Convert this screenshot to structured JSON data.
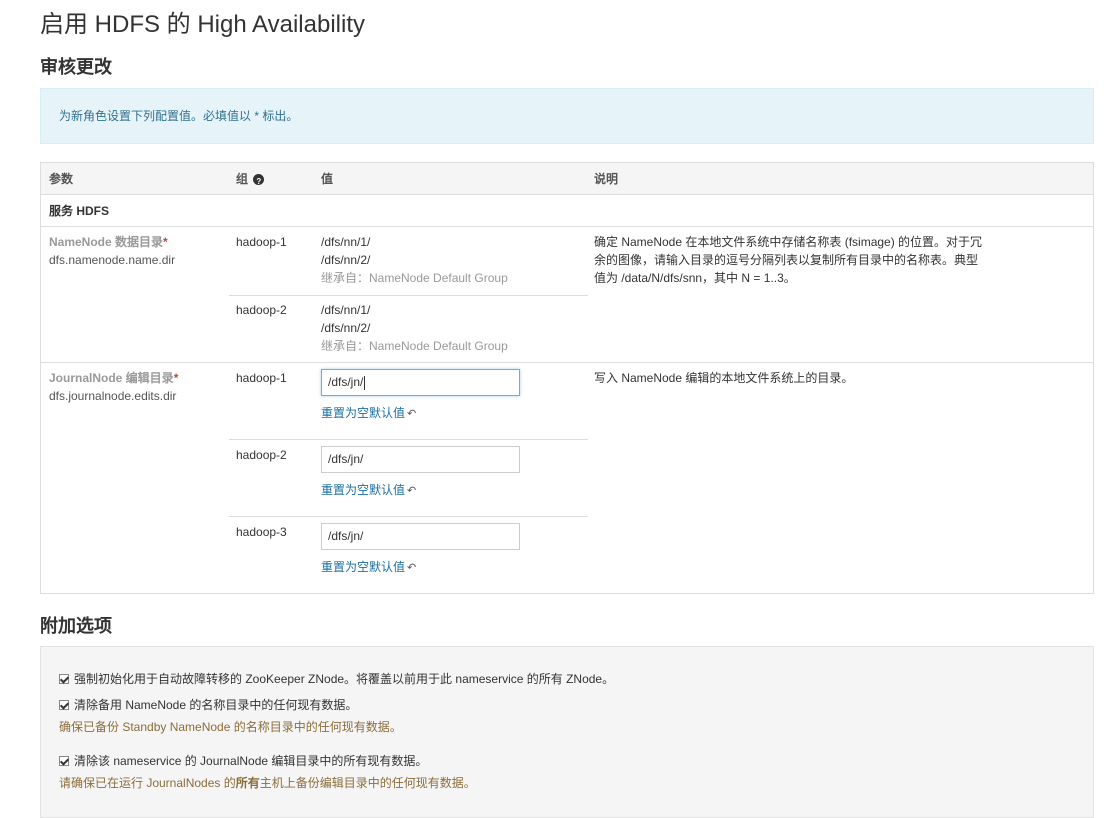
{
  "title": "启用 HDFS 的 High Availability",
  "review_section_title": "审核更改",
  "info_alert": "为新角色设置下列配置值。必填值以 * 标出。",
  "table": {
    "headers": {
      "param": "参数",
      "group": "组",
      "value": "值",
      "desc": "说明"
    },
    "service_row": "服务 HDFS",
    "namenode_dir": {
      "label": "NameNode 数据目录",
      "required_mark": "*",
      "key": "dfs.namenode.name.dir",
      "description": "确定 NameNode 在本地文件系统中存储名称表 (fsimage) 的位置。对于冗余的图像，请输入目录的逗号分隔列表以复制所有目录中的名称表。典型值为 /data/N/dfs/snn，其中 N = 1..3。",
      "groups": [
        {
          "name": "hadoop-1",
          "values": [
            "/dfs/nn/1/",
            "/dfs/nn/2/"
          ],
          "inherited": "继承自：NameNode Default Group"
        },
        {
          "name": "hadoop-2",
          "values": [
            "/dfs/nn/1/",
            "/dfs/nn/2/"
          ],
          "inherited": "继承自：NameNode Default Group"
        }
      ]
    },
    "journalnode_dir": {
      "label": "JournalNode 编辑目录",
      "required_mark": "*",
      "key": "dfs.journalnode.edits.dir",
      "description": "写入 NameNode 编辑的本地文件系统上的目录。",
      "reset_label": "重置为空默认值",
      "groups": [
        {
          "name": "hadoop-1",
          "value": "/dfs/jn/"
        },
        {
          "name": "hadoop-2",
          "value": "/dfs/jn/"
        },
        {
          "name": "hadoop-3",
          "value": "/dfs/jn/"
        }
      ]
    }
  },
  "extra_section_title": "附加选项",
  "options": [
    {
      "label": "强制初始化用于自动故障转移的 ZooKeeper ZNode。将覆盖以前用于此 nameservice 的所有 ZNode。",
      "checked": true
    },
    {
      "label": "清除备用 NameNode 的名称目录中的任何现有数据。",
      "checked": true,
      "warning": "确保已备份 Standby NameNode 的名称目录中的任何现有数据。"
    },
    {
      "label": "清除该 nameservice 的 JournalNode 编辑目录中的所有现有数据。",
      "checked": true,
      "warning_pre": "请确保已在运行 JournalNodes 的",
      "warning_bold": "所有",
      "warning_post": "主机上备份编辑目录中的任何现有数据。"
    }
  ]
}
